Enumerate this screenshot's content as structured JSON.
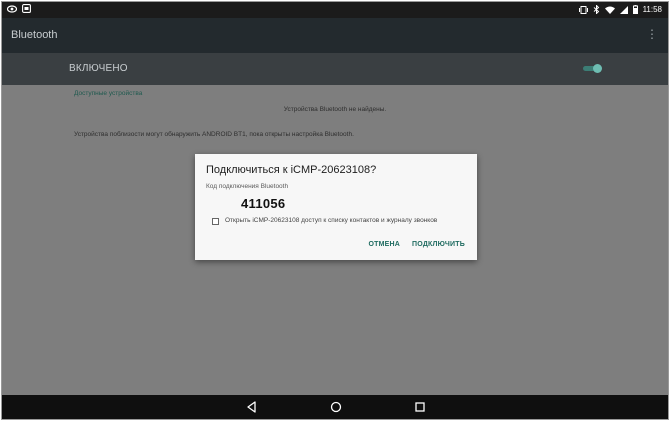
{
  "status_bar": {
    "time": "11:58",
    "left_icons": [
      "eye-icon",
      "notification-app-icon"
    ],
    "right_icons": [
      "vibrate-icon",
      "bluetooth-icon",
      "wifi-icon",
      "signal-icon",
      "battery-icon"
    ]
  },
  "app_bar": {
    "title": "Bluetooth"
  },
  "switch_bar": {
    "label": "ВКЛЮЧЕНО",
    "enabled": true
  },
  "content": {
    "section_header": "Доступные устройства",
    "empty_text": "Устройства Bluetooth не найдены.",
    "visible_text": "Устройства поблизости могут обнаружить ANDROID BT1, пока открыты настройка Bluetooth."
  },
  "dialog": {
    "title": "Подключиться к iCMP-20623108?",
    "caption": "Код подключения Bluetooth",
    "code": "411056",
    "checkbox_label": "Открыть iCMP-20623108 доступ к списку контактов и журналу звонков",
    "checkbox_checked": false,
    "cancel_label": "ОТМЕНА",
    "connect_label": "ПОДКЛЮЧИТЬ"
  },
  "colors": {
    "accent": "#1f6b60",
    "toggle_on": "#6ebdb2",
    "app_bar": "#232a2e",
    "switch_bar": "#3a3f42",
    "scrim": "#7e7e7e"
  }
}
